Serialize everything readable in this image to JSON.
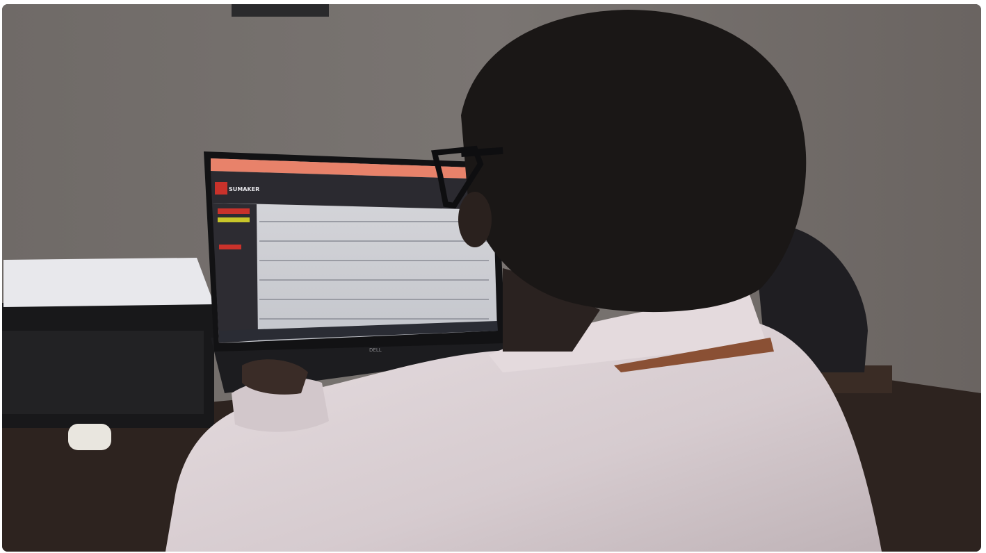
{
  "photo": {
    "subject": "person-at-laptop",
    "screen_brand_text": "SUMAKER",
    "laptop_logo_text": "DELL"
  },
  "colors": {
    "wall": "#6e6966",
    "desk": "#2b211d",
    "shirt": "#d9cfd2",
    "hair": "#1a1716",
    "screen_header": "#2b2a30",
    "browser_bar": "#e8826a",
    "accent_red": "#c9322b",
    "accent_yellow": "#c8c62a"
  }
}
